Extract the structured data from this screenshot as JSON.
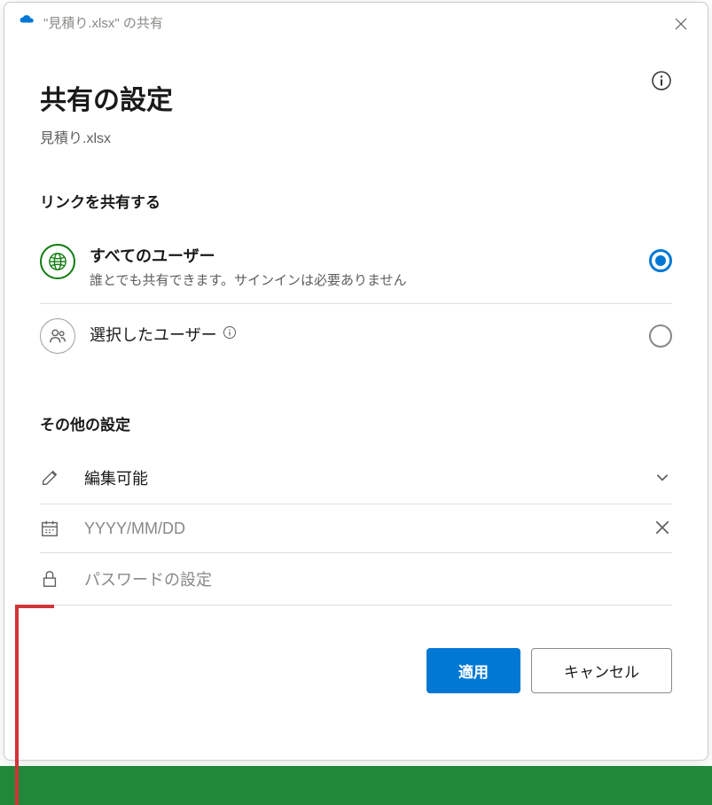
{
  "titlebar": {
    "text": "\"見積り.xlsx\" の共有"
  },
  "header": {
    "heading": "共有の設定",
    "filename": "見積り.xlsx"
  },
  "share_section": {
    "label": "リンクを共有する",
    "options": {
      "all_users": {
        "title": "すべてのユーザー",
        "desc": "誰とでも共有できます。サインインは必要ありません"
      },
      "selected_users": {
        "title": "選択したユーザー"
      }
    }
  },
  "other_settings": {
    "label": "その他の設定",
    "permission": "編集可能",
    "date_placeholder": "YYYY/MM/DD",
    "password_placeholder": "パスワードの設定"
  },
  "buttons": {
    "apply": "適用",
    "cancel": "キャンセル"
  }
}
